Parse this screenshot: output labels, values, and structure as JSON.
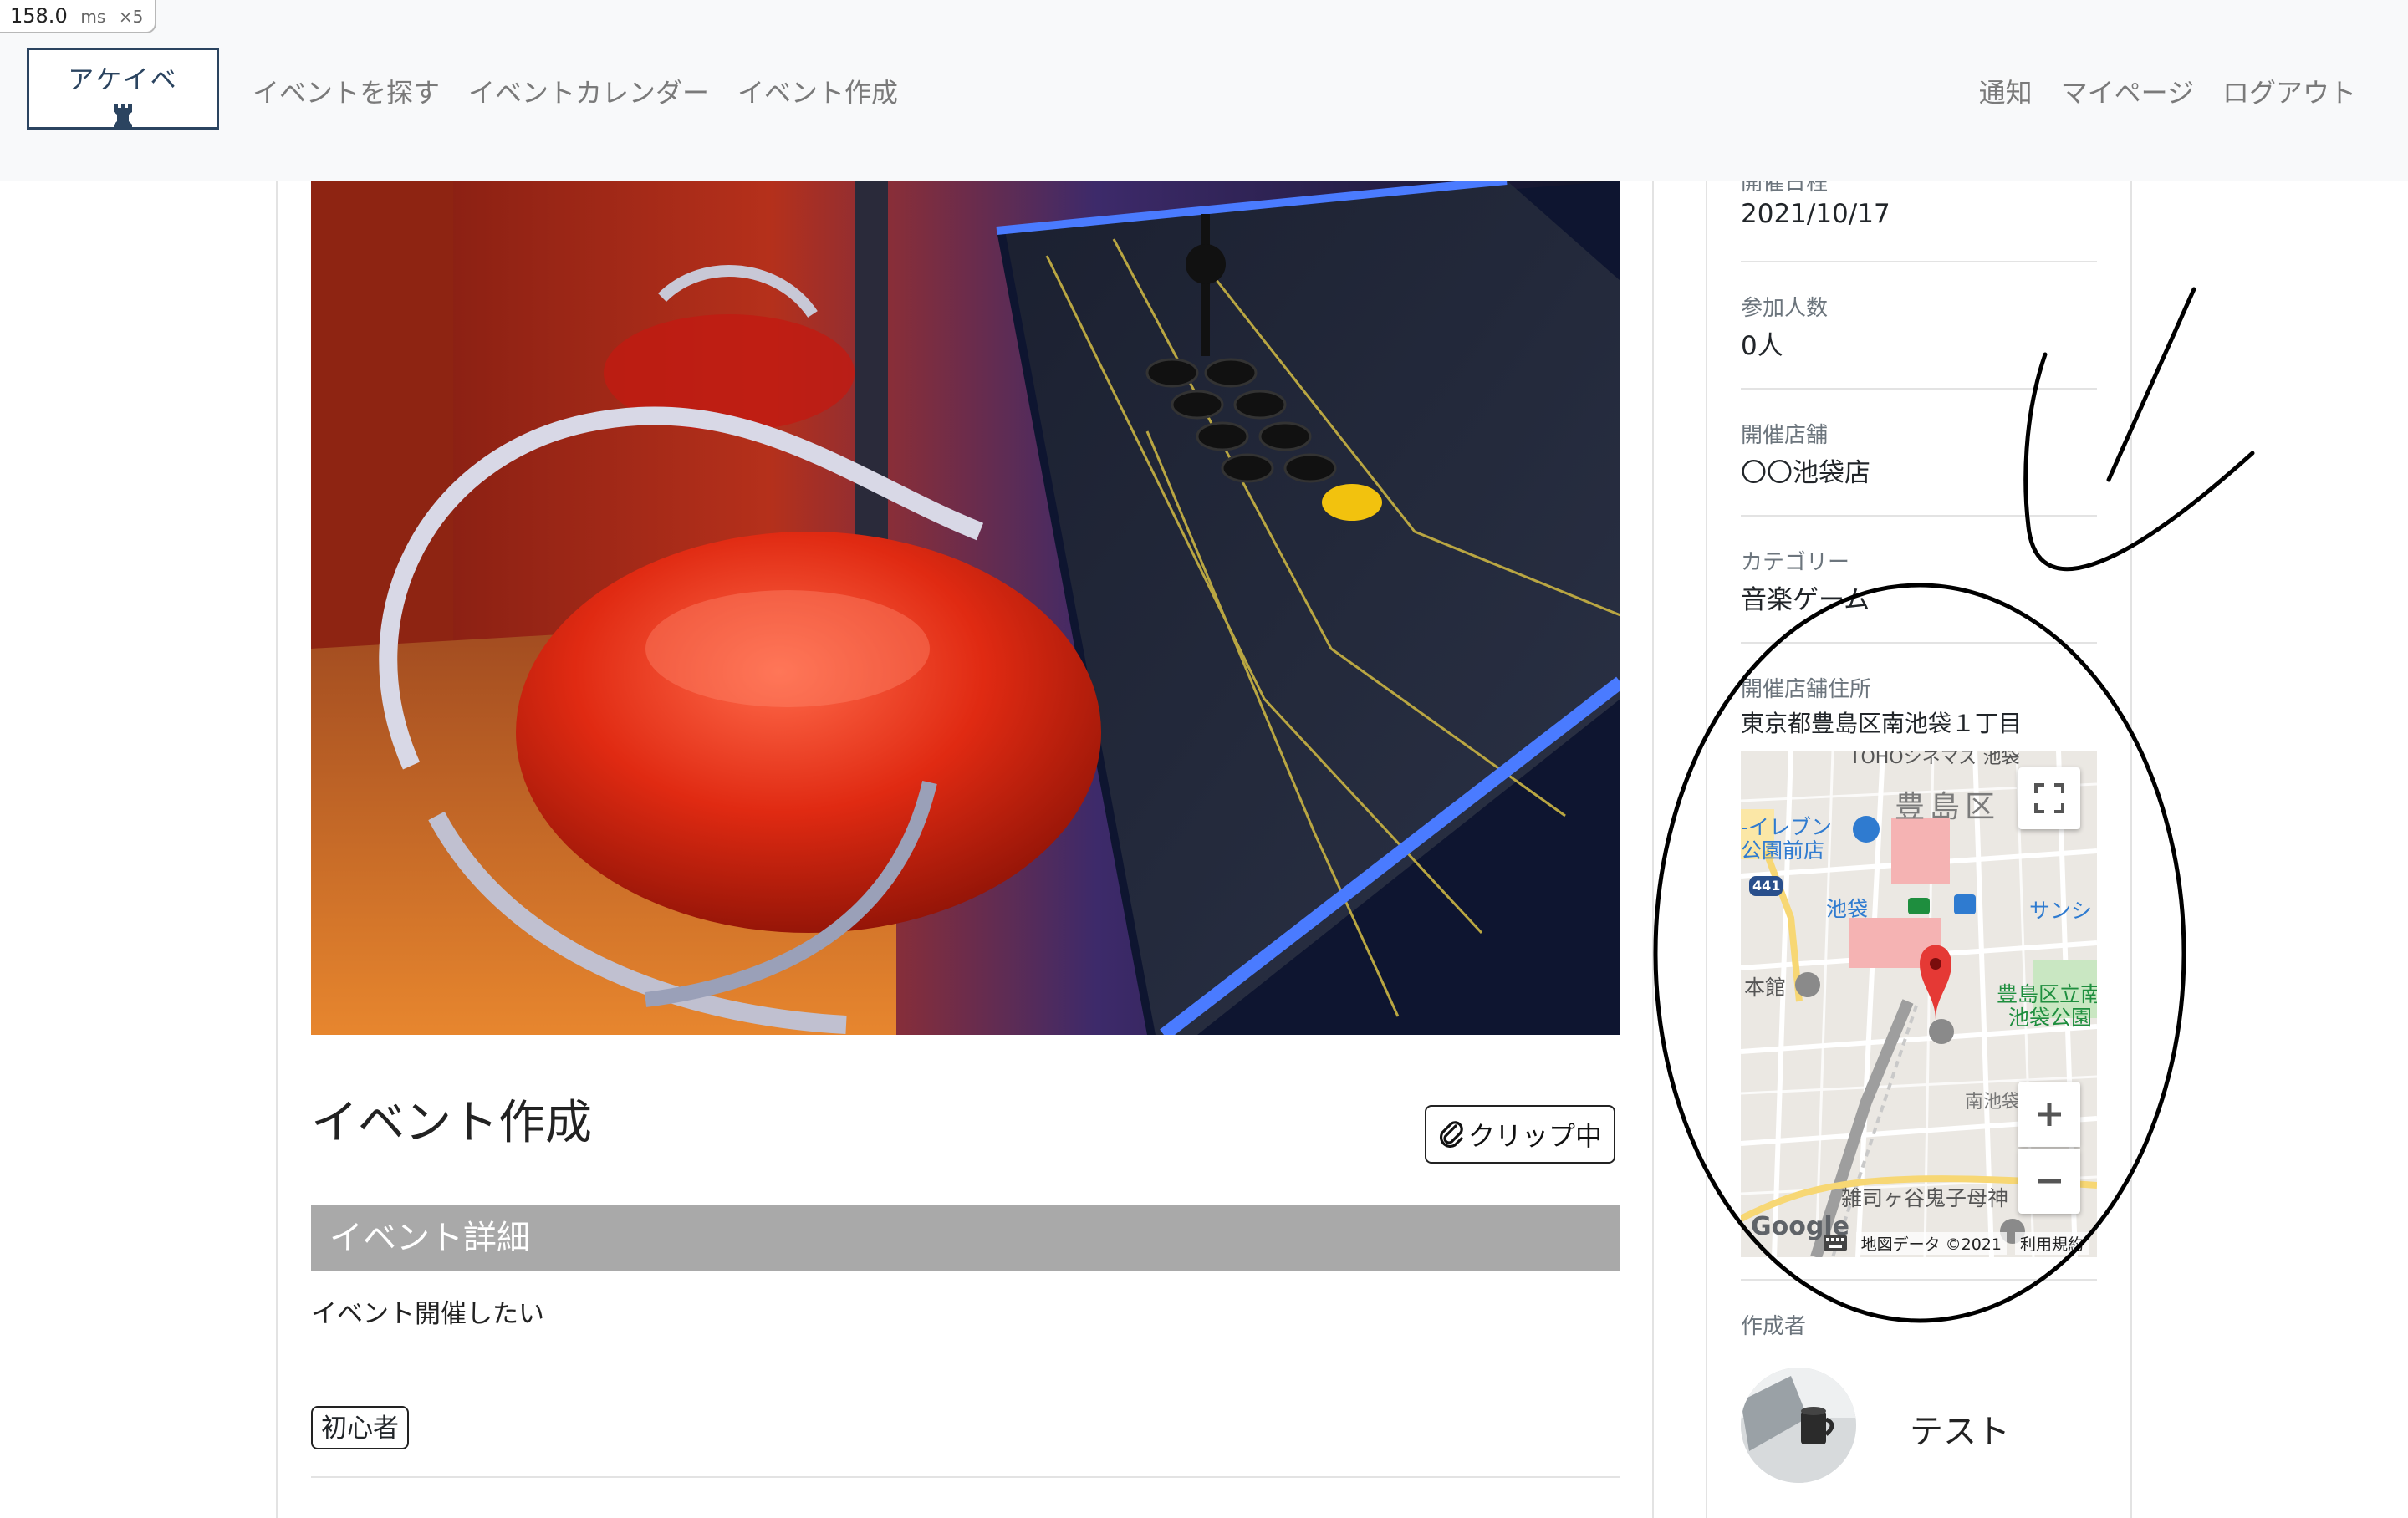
{
  "perf": {
    "value": "158.0",
    "unit": "ms",
    "multiplier": "×5"
  },
  "navbar": {
    "brand": "アケイベ",
    "left_links": [
      "イベントを探す",
      "イベントカレンダー",
      "イベント作成"
    ],
    "right_links": [
      "通知",
      "マイページ",
      "ログアウト"
    ]
  },
  "event": {
    "title": "イベント作成",
    "clip_label": "クリップ中",
    "section_heading": "イベント詳細",
    "description": "イベント開催したい",
    "tag": "初心者"
  },
  "sidebar": {
    "date_label": "開催日程",
    "date_value": "2021/10/17",
    "participants_label": "参加人数",
    "participants_value": "0人",
    "store_label": "開催店舗",
    "store_value": "〇〇池袋店",
    "category_label": "カテゴリー",
    "category_value": "音楽ゲーム",
    "address_label": "開催店舗住所",
    "address_value": "東京都豊島区南池袋１丁目",
    "author_label": "作成者",
    "author_name": "テスト"
  },
  "map": {
    "labels": {
      "ward": "豊島区",
      "toho": "TOHOシネマズ 池袋",
      "eleven": "-イレブン",
      "park_front": "公園前店",
      "route": "441",
      "ikebukuro": "池袋",
      "sunshine": "サンシ",
      "honkan": "本館",
      "park": "豊島区立南",
      "park2": "池袋公園",
      "minami": "南池袋",
      "zoshigaya": "雑司ヶ谷鬼子母神",
      "google": "Google"
    },
    "footer_data": "地図データ ©2021",
    "footer_terms": "利用規約"
  },
  "colors": {
    "navbar_bg": "#f8f9fa",
    "brand": "#2b4460",
    "section_bar": "#a9a9a9",
    "map_pin": "#e53935"
  }
}
